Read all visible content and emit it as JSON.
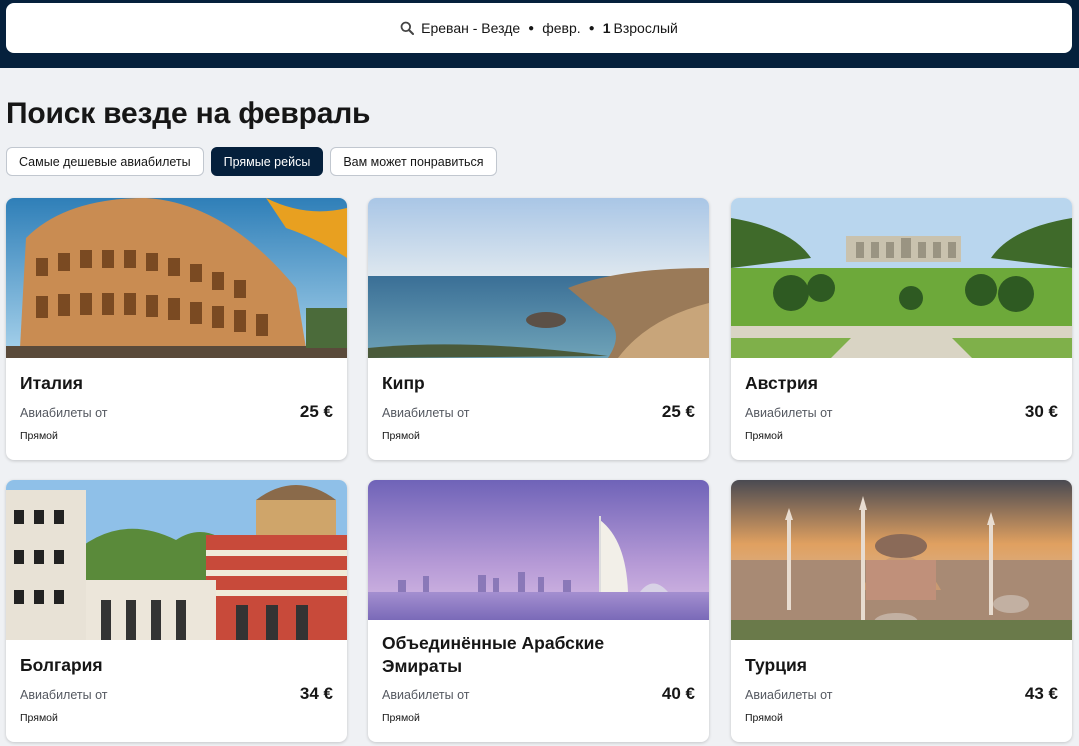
{
  "search": {
    "route": "Ереван - Везде",
    "month": "февр.",
    "passengers_count": "1",
    "passengers_label": "Взрослый"
  },
  "page_title": "Поиск везде на февраль",
  "filters": [
    {
      "label": "Самые дешевые авиабилеты",
      "active": false
    },
    {
      "label": "Прямые рейсы",
      "active": true
    },
    {
      "label": "Вам может понравиться",
      "active": false
    }
  ],
  "destinations": [
    {
      "name": "Италия",
      "from_label": "Авиабилеты от",
      "price": "25 €",
      "stops": "Прямой"
    },
    {
      "name": "Кипр",
      "from_label": "Авиабилеты от",
      "price": "25 €",
      "stops": "Прямой"
    },
    {
      "name": "Австрия",
      "from_label": "Авиабилеты от",
      "price": "30 €",
      "stops": "Прямой"
    },
    {
      "name": "Болгария",
      "from_label": "Авиабилеты от",
      "price": "34 €",
      "stops": "Прямой"
    },
    {
      "name": "Объединённые Арабские Эмираты",
      "from_label": "Авиабилеты от",
      "price": "40 €",
      "stops": "Прямой"
    },
    {
      "name": "Турция",
      "from_label": "Авиабилеты от",
      "price": "43 €",
      "stops": "Прямой"
    }
  ],
  "colors": {
    "header_bg": "#05203c",
    "page_bg": "#eff1f4",
    "active_chip": "#05203c"
  }
}
